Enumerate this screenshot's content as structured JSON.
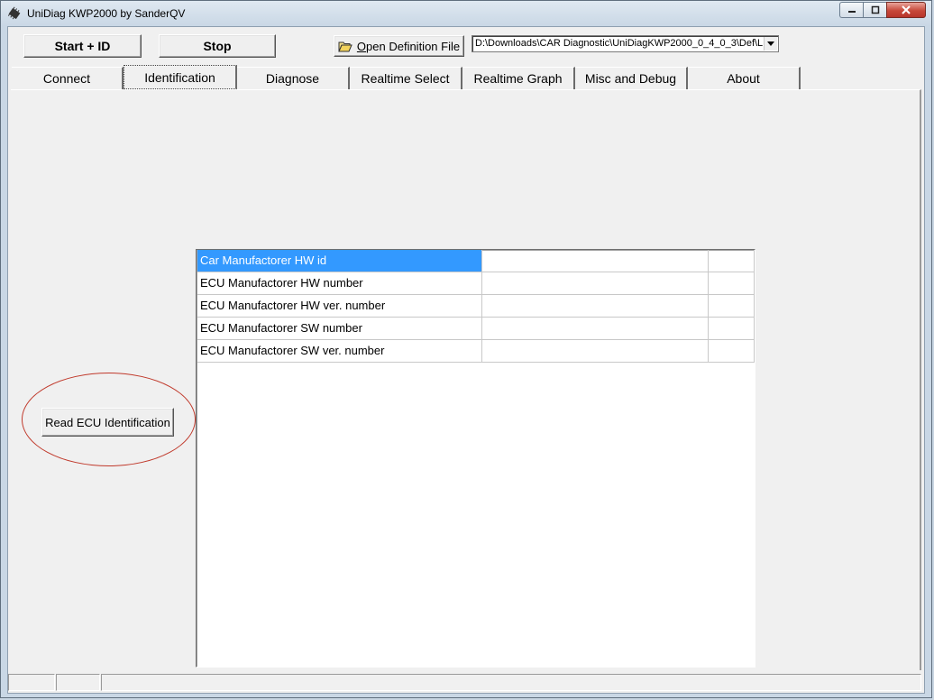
{
  "window": {
    "title": "UniDiag KWP2000 by SanderQV",
    "icon": "chip-icon"
  },
  "toolbar": {
    "start_id_label": "Start + ID",
    "stop_label": "Stop",
    "open_def_prefix": "O",
    "open_def_rest": "pen Definition File",
    "definition_path": "D:\\Downloads\\CAR Diagnostic\\UniDiagKWP2000_0_4_0_3\\Def\\L"
  },
  "tabs": [
    {
      "label": "Connect"
    },
    {
      "label": "Identification"
    },
    {
      "label": "Diagnose"
    },
    {
      "label": "Realtime Select"
    },
    {
      "label": "Realtime Graph"
    },
    {
      "label": "Misc and Debug"
    },
    {
      "label": "About"
    }
  ],
  "active_tab": "Identification",
  "identification": {
    "read_button_label": "Read ECU Identification",
    "rows": [
      {
        "label": "Car Manufactorer HW id",
        "value": "",
        "extra": "",
        "selected": true
      },
      {
        "label": "ECU Manufactorer HW number",
        "value": "",
        "extra": ""
      },
      {
        "label": "ECU Manufactorer HW ver. number",
        "value": "",
        "extra": ""
      },
      {
        "label": "ECU Manufactorer SW number",
        "value": "",
        "extra": ""
      },
      {
        "label": "ECU Manufactorer SW ver. number",
        "value": "",
        "extra": ""
      }
    ]
  },
  "colors": {
    "selection": "#3399ff",
    "annotation_circle": "#c0392b"
  }
}
